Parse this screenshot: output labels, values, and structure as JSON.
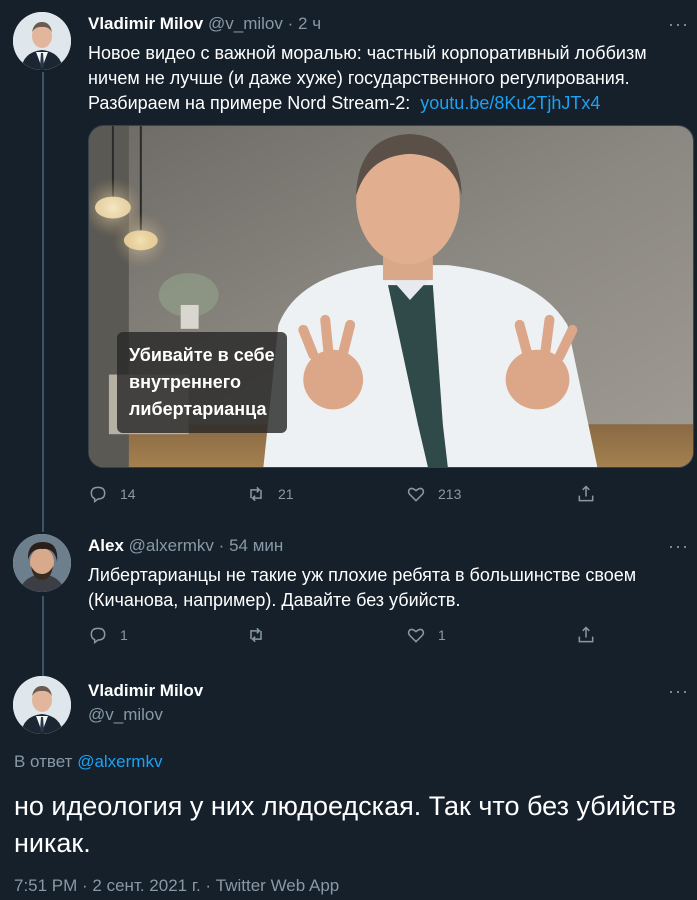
{
  "tweets": [
    {
      "name": "Vladimir Milov",
      "handle": "@v_milov",
      "dot": "·",
      "time": "2 ч",
      "text_lines": [
        "Новое видео с важной моралью: частный корпоративный лоббизм",
        "ничем не лучше (и даже хуже) государственного регулирования."
      ],
      "text_last_prefix": "Разбираем на примере Nord Stream-2:",
      "link": "youtu.be/8Ku2TjhJTx4",
      "media_caption": [
        "Убивайте в себе",
        "внутреннего",
        "либертарианца"
      ],
      "replies": "14",
      "retweets": "21",
      "likes": "213"
    },
    {
      "name": "Alex",
      "handle": "@alxermkv",
      "dot": "·",
      "time": "54 мин",
      "text_lines": [
        "Либертарианцы не такие уж плохие ребята в большинстве своем",
        "(Кичанова, например). Давайте без убийств."
      ],
      "replies": "1",
      "retweets": "",
      "likes": "1"
    }
  ],
  "focus": {
    "name": "Vladimir Milov",
    "handle": "@v_milov",
    "reply_prefix": "В ответ",
    "reply_to": "@alxermkv",
    "text": "но идеология у них людоедская. Так что без убийств никак.",
    "meta": "7:51 PM · 2 сент. 2021 г. · Twitter Web App"
  },
  "ui": {
    "more": "···"
  },
  "colors": {
    "background": "#15202b",
    "muted": "#8899a6",
    "link": "#1da1f2",
    "thread_line": "#3d5466"
  },
  "icons": [
    "reply-icon",
    "retweet-icon",
    "like-icon",
    "share-icon",
    "more-icon"
  ]
}
